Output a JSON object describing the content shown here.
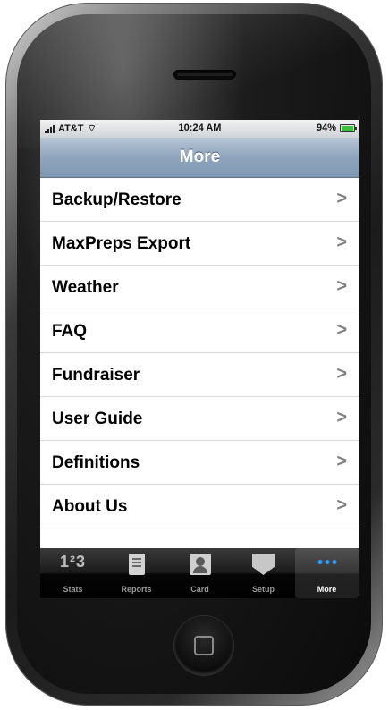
{
  "status_bar": {
    "carrier": "AT&T",
    "time": "10:24 AM",
    "battery": "94%"
  },
  "nav": {
    "title": "More"
  },
  "menu": {
    "items": [
      {
        "label": "Backup/Restore",
        "chevron": ">"
      },
      {
        "label": "MaxPreps Export",
        "chevron": ">"
      },
      {
        "label": "Weather",
        "chevron": ">"
      },
      {
        "label": "FAQ",
        "chevron": ">"
      },
      {
        "label": "Fundraiser",
        "chevron": ">"
      },
      {
        "label": "User Guide",
        "chevron": ">"
      },
      {
        "label": "Definitions",
        "chevron": ">"
      },
      {
        "label": "About Us",
        "chevron": ">"
      }
    ]
  },
  "tabbar": {
    "tabs": [
      {
        "label": "Stats",
        "icon": "stats-123-icon",
        "glyph": "1²3"
      },
      {
        "label": "Reports",
        "icon": "reports-icon"
      },
      {
        "label": "Card",
        "icon": "card-icon"
      },
      {
        "label": "Setup",
        "icon": "setup-icon"
      },
      {
        "label": "More",
        "icon": "more-dots-icon",
        "active": true
      }
    ]
  },
  "colors": {
    "nav_bar": "#8fa5bd",
    "active_tab_dots": "#2f9bff",
    "battery_fill": "#3fbf3f"
  }
}
